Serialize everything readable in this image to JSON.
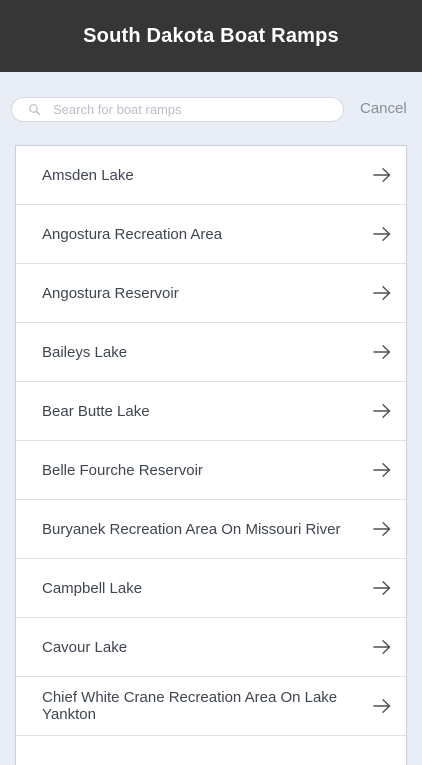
{
  "header": {
    "title": "South Dakota Boat Ramps"
  },
  "search": {
    "placeholder": "Search for boat ramps",
    "value": "",
    "icon": "search-icon",
    "cancel_label": "Cancel"
  },
  "list": {
    "item_icon": "arrow-right-icon",
    "items": [
      {
        "label": "Amsden Lake"
      },
      {
        "label": "Angostura Recreation Area"
      },
      {
        "label": "Angostura Reservoir"
      },
      {
        "label": "Baileys Lake"
      },
      {
        "label": "Bear Butte Lake"
      },
      {
        "label": "Belle Fourche Reservoir"
      },
      {
        "label": "Buryanek Recreation Area On Missouri River"
      },
      {
        "label": "Campbell Lake"
      },
      {
        "label": "Cavour Lake"
      },
      {
        "label": "Chief White Crane Recreation Area On Lake Yankton"
      }
    ]
  },
  "colors": {
    "header_bg": "#363636",
    "page_bg": "#e9eef6",
    "text": "#3f4650",
    "muted": "#8a8f97"
  }
}
